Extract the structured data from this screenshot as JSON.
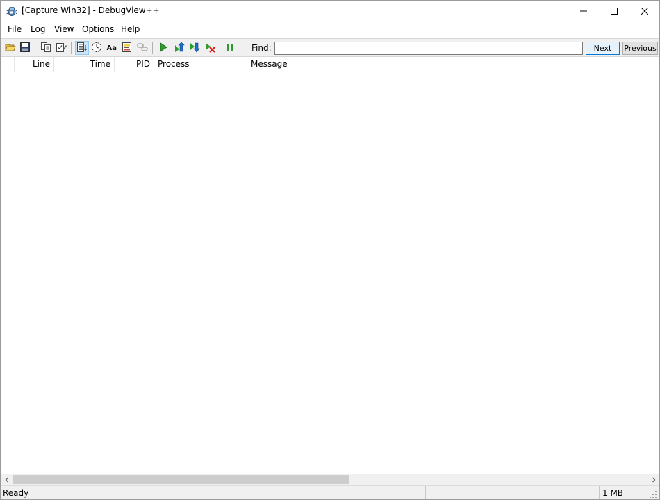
{
  "window": {
    "title": "[Capture Win32] - DebugView++",
    "controls": {
      "minimize": "minimize-icon",
      "maximize": "maximize-icon",
      "close": "close-icon"
    }
  },
  "menu": {
    "items": [
      "File",
      "Log",
      "View",
      "Options",
      "Help"
    ]
  },
  "toolbar": {
    "icons": [
      "open-folder-icon",
      "save-icon",
      "copy-icon",
      "edit-filter-icon",
      "autoscroll-icon",
      "clock-icon",
      "font-icon",
      "highlight-icon",
      "link-icon",
      "play-icon",
      "bookmark-up-icon",
      "bookmark-down-icon",
      "clear-bookmarks-icon",
      "pause-icon"
    ],
    "find_label": "Find:",
    "find_value": "",
    "next_label": "Next",
    "previous_label": "Previous"
  },
  "columns": [
    "",
    "Line",
    "Time",
    "PID",
    "Process",
    "Message"
  ],
  "rows": [],
  "status": {
    "ready": "Ready",
    "pane2": "",
    "pane3": "",
    "pane4": "",
    "memory": "1 MB"
  },
  "colors": {
    "accent": "#0078d7",
    "play_green": "#2e9d2e",
    "bookmark_blue": "#1f6fd0",
    "delete_red": "#d91e1e"
  }
}
